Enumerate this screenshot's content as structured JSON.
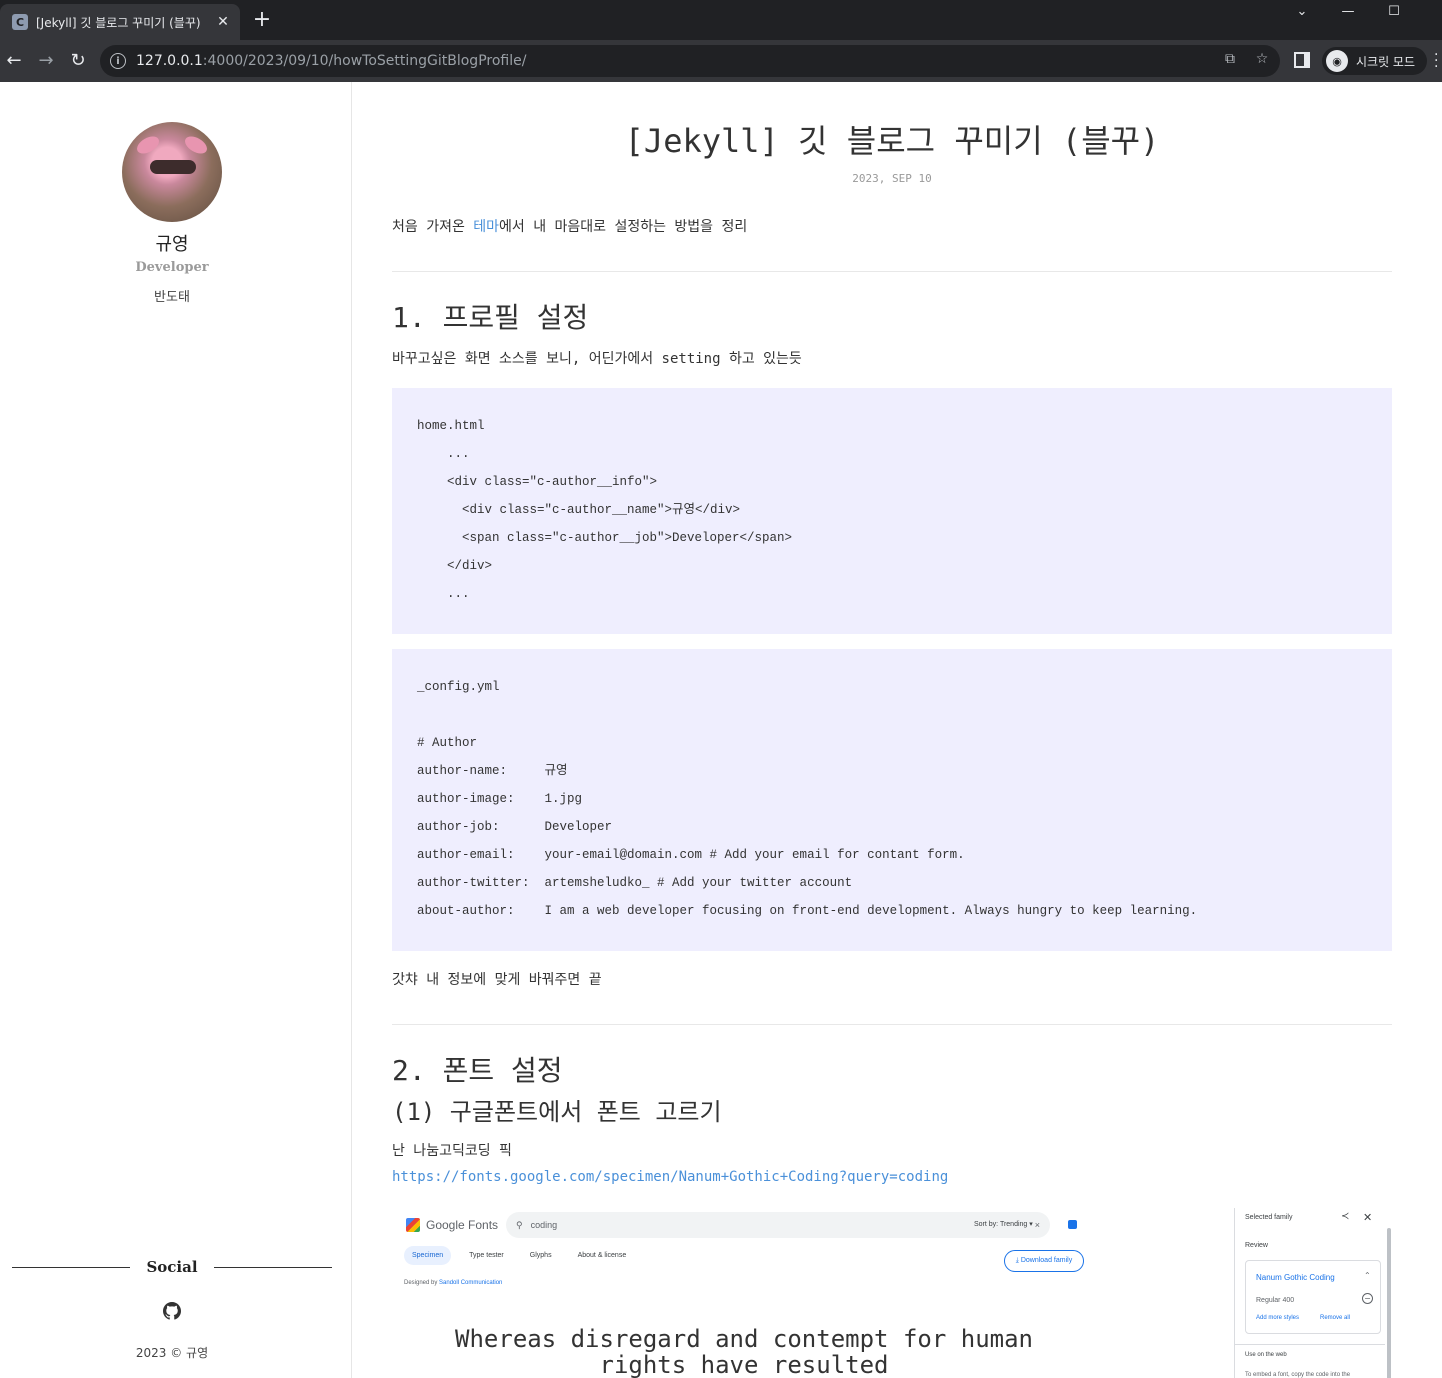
{
  "browser": {
    "tab_favicon": "C",
    "tab_title": "[Jekyll] 깃 블로그 꾸미기 (블꾸)",
    "url_host": "127.0.0.1",
    "url_path": ":4000/2023/09/10/howToSettingGitBlogProfile/",
    "incognito_label": "시크릿 모드"
  },
  "sidebar": {
    "author_name": "규영",
    "author_job": "Developer",
    "author_info": "반도태",
    "social_title": "Social",
    "copyright": "2023 © 규영"
  },
  "post": {
    "title": "[Jekyll] 깃 블로그 꾸미기 (블꾸)",
    "date": "2023, SEP 10",
    "intro_before": "처음 가져온 ",
    "intro_link": "테마",
    "intro_after": "에서 내 마음대로 설정하는 방법을 정리",
    "section1_heading": "1. 프로필 설정",
    "section1_text": "바꾸고싶은 화면 소스를 보니, 어딘가에서 setting 하고 있는듯",
    "code1": [
      "home.html",
      "    ...",
      "    <div class=\"c-author__info\">",
      "      <div class=\"c-author__name\">규영</div>",
      "      <span class=\"c-author__job\">Developer</span>",
      "    </div>",
      "    ..."
    ],
    "code2": [
      "_config.yml",
      "",
      "# Author",
      "author-name:     규영",
      "author-image:    1.jpg   ",
      "author-job:      Developer",
      "author-email:    your-email@domain.com # Add your email for contant form.",
      "author-twitter:  artemsheludko_ # Add your twitter account",
      "about-author:    I am a web developer focusing on front-end development. Always hungry to keep learning."
    ],
    "section1_after": "갓챠 내 정보에 맞게 바꿔주면 끝",
    "section2_heading": "2. 폰트 설정",
    "section2_sub": "(1) 구글폰트에서 폰트 고르기",
    "section2_text": "난 나눔고딕코딩 픽",
    "section2_link": "https://fonts.google.com/specimen/Nanum+Gothic+Coding?query=coding"
  },
  "screenshot": {
    "logo_text": "Google Fonts",
    "search_query": "coding",
    "search_clear": "×",
    "sort_label": "Sort by: Trending ▾",
    "tabs": [
      "Specimen",
      "Type tester",
      "Glyphs",
      "About & license"
    ],
    "download_label": "⤓ Download family",
    "designer_prefix": "Designed by ",
    "designer_name": "Sandoll Communication",
    "sample_text": "Whereas disregard and contempt for human rights have resulted",
    "panel_title": "Selected family",
    "review_label": "Review",
    "family_name": "Nanum Gothic Coding",
    "style_label": "Regular 400",
    "add_styles": "Add more styles",
    "remove_all": "Remove all",
    "web_label": "Use on the web",
    "embed_hint": "To embed a font, copy the code into the"
  },
  "colors": {
    "accent_link": "#4a90d9",
    "code_bg": "#efeefe",
    "chrome_dark": "#202124"
  }
}
